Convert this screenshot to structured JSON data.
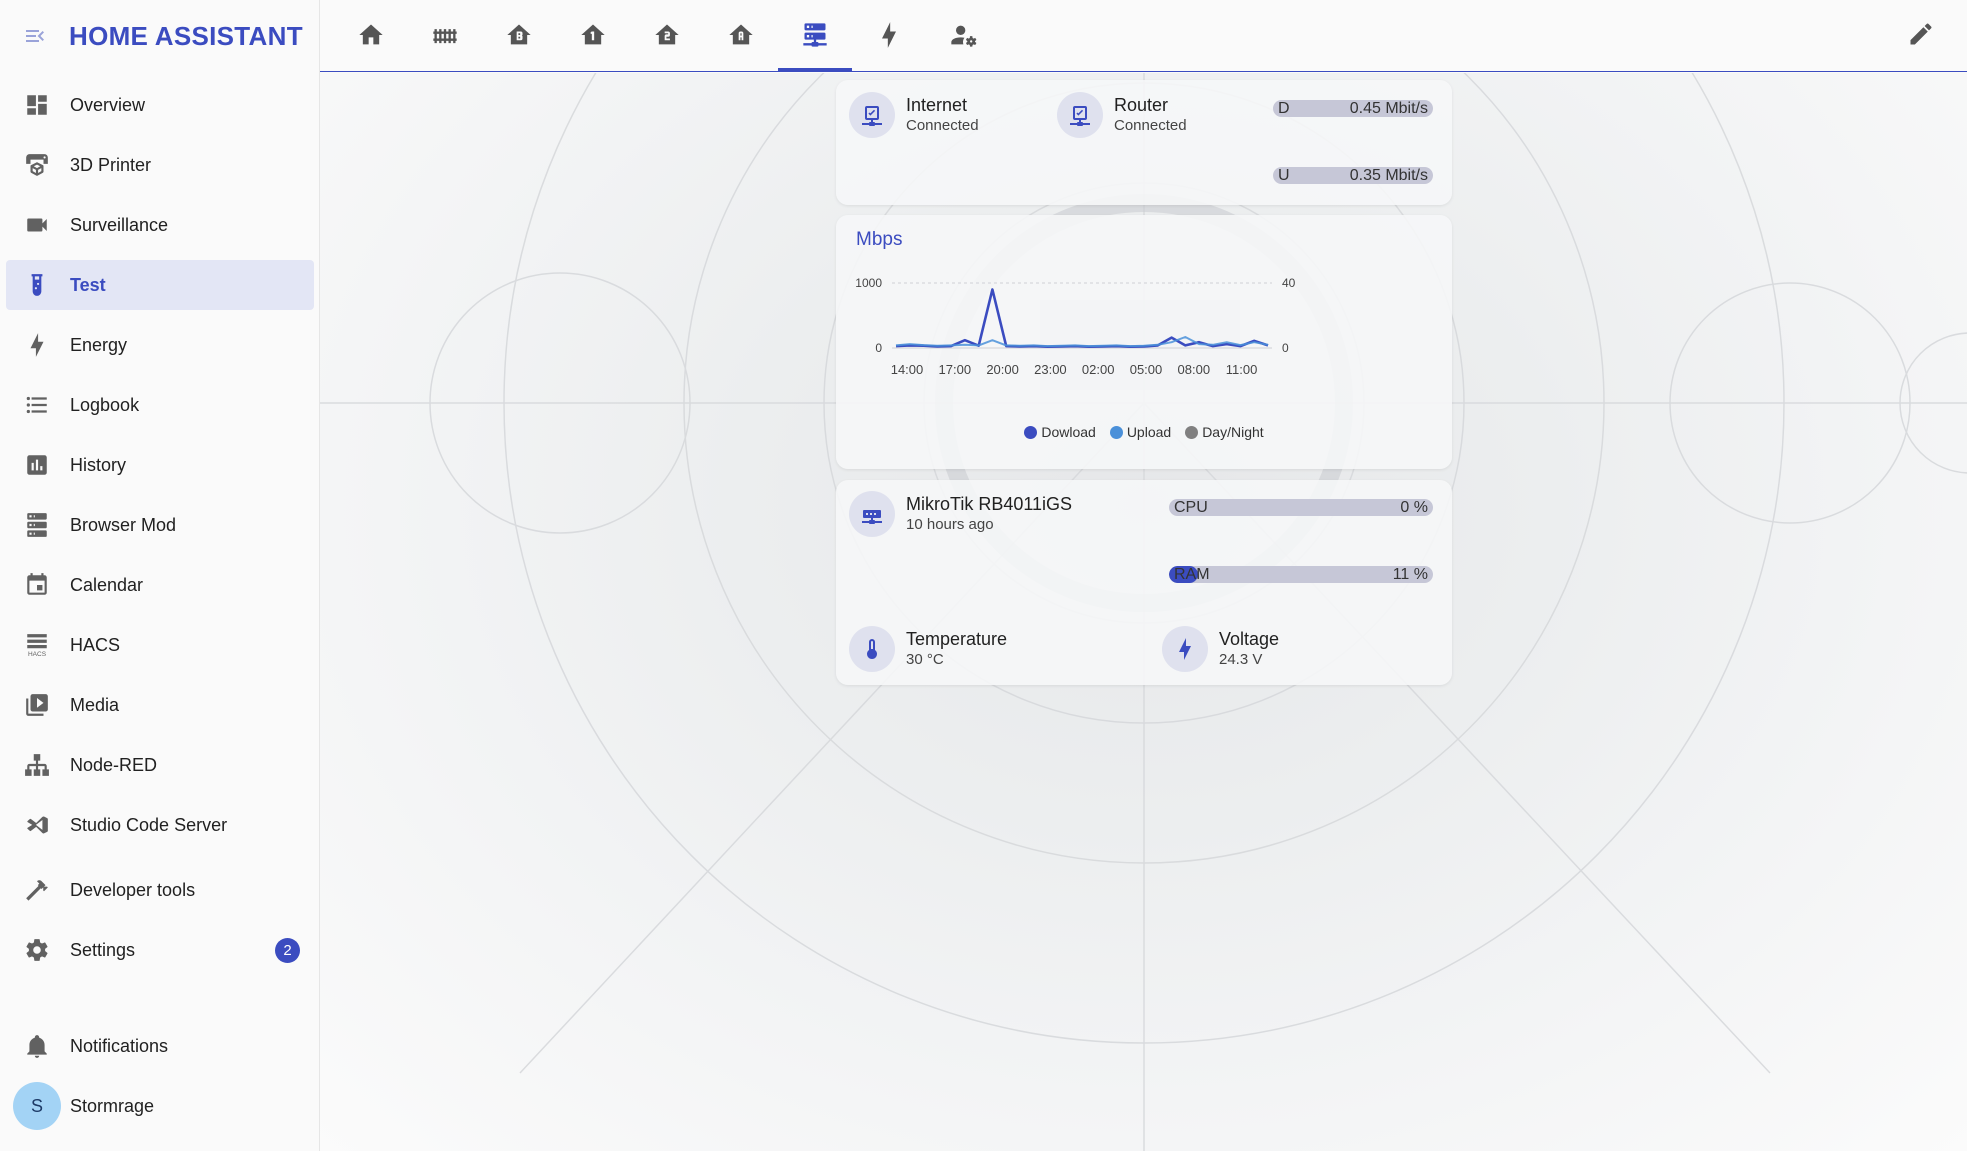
{
  "app": {
    "title": "HOME ASSISTANT"
  },
  "sidebar": {
    "items": [
      {
        "label": "Overview"
      },
      {
        "label": "3D Printer"
      },
      {
        "label": "Surveillance"
      },
      {
        "label": "Test",
        "active": true
      },
      {
        "label": "Energy"
      },
      {
        "label": "Logbook"
      },
      {
        "label": "History"
      },
      {
        "label": "Browser Mod"
      },
      {
        "label": "Calendar"
      },
      {
        "label": "HACS"
      },
      {
        "label": "Media"
      },
      {
        "label": "Node-RED"
      },
      {
        "label": "Studio Code Server"
      }
    ],
    "developer_tools": "Developer tools",
    "settings": {
      "label": "Settings",
      "badge": "2"
    },
    "notifications": "Notifications",
    "user": {
      "name": "Stormrage",
      "initial": "S"
    }
  },
  "topbar": {
    "tabs": [
      "home-icon",
      "fence-icon",
      "floor-b-icon",
      "floor-1-icon",
      "floor-2-icon",
      "floor-a-icon",
      "server-network-icon",
      "lightning-icon",
      "account-wrench-icon"
    ],
    "active_tab": 6
  },
  "network_card": {
    "internet": {
      "name": "Internet",
      "state": "Connected"
    },
    "router": {
      "name": "Router",
      "state": "Connected"
    },
    "download": {
      "label": "D",
      "value": "0.45 Mbit/s"
    },
    "upload": {
      "label": "U",
      "value": "0.35 Mbit/s"
    }
  },
  "chart_data": {
    "type": "line",
    "title": "Mbps",
    "x": [
      "14:00",
      "17:00",
      "20:00",
      "23:00",
      "02:00",
      "05:00",
      "08:00",
      "11:00"
    ],
    "y_left_ticks": [
      "1000",
      "0"
    ],
    "y_right_ticks": [
      "40",
      "0"
    ],
    "ylim_left": [
      0,
      1000
    ],
    "ylim_right": [
      0,
      40
    ],
    "series": [
      {
        "name": "Dowload",
        "color": "#3b4cc0",
        "values": [
          30,
          40,
          35,
          25,
          30,
          120,
          35,
          900,
          30,
          25,
          30,
          20,
          25,
          30,
          20,
          25,
          30,
          20,
          25,
          40,
          160,
          40,
          90,
          30,
          60,
          30,
          110,
          40
        ]
      },
      {
        "name": "Upload",
        "color": "#4a90d9",
        "values": [
          40,
          60,
          45,
          35,
          40,
          50,
          40,
          120,
          40,
          35,
          40,
          30,
          35,
          40,
          30,
          35,
          40,
          30,
          35,
          50,
          90,
          170,
          60,
          50,
          90,
          45,
          90,
          50
        ]
      },
      {
        "name": "Day/Night",
        "color": "#808080"
      }
    ],
    "grid": true,
    "legend_position": "bottom"
  },
  "router_card": {
    "device": {
      "name": "MikroTik RB4011iGS",
      "state": "10 hours ago"
    },
    "cpu": {
      "label": "CPU",
      "value": "0 %",
      "percent": 0
    },
    "ram": {
      "label": "RAM",
      "value": "11 %",
      "percent": 11
    },
    "temperature": {
      "name": "Temperature",
      "state": "30 °C"
    },
    "voltage": {
      "name": "Voltage",
      "state": "24.3 V"
    }
  }
}
